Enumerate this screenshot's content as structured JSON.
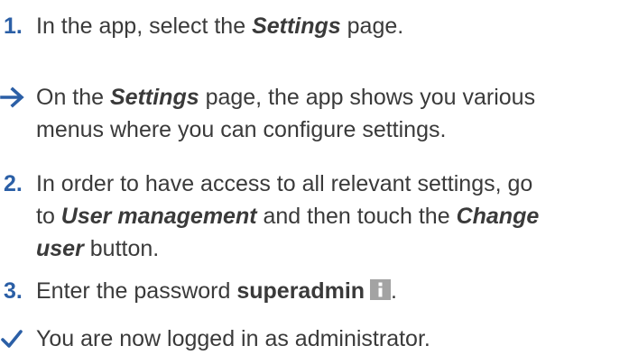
{
  "colors": {
    "accent": "#2b5fa6",
    "text": "#3a3a3a",
    "info_icon": "#a3a3a3"
  },
  "steps": [
    {
      "number": "1.",
      "parts": [
        "In the app, select the ",
        "Settings",
        " page."
      ]
    },
    {
      "marker_icon": "arrow-right-icon",
      "parts": [
        "On the ",
        "Settings",
        " page, the app shows you various",
        "menus where you can configure settings."
      ]
    },
    {
      "number": "2.",
      "parts": [
        "In order to have access to all relevant settings, go",
        "to ",
        "User management",
        " and then touch the ",
        "Change",
        "user",
        " button."
      ]
    },
    {
      "number": "3.",
      "parts": [
        "Enter the password ",
        "superadmin",
        "."
      ],
      "info_icon": "info-icon"
    },
    {
      "marker_icon": "checkmark-icon",
      "parts": [
        "You are now logged in as administrator."
      ]
    }
  ]
}
